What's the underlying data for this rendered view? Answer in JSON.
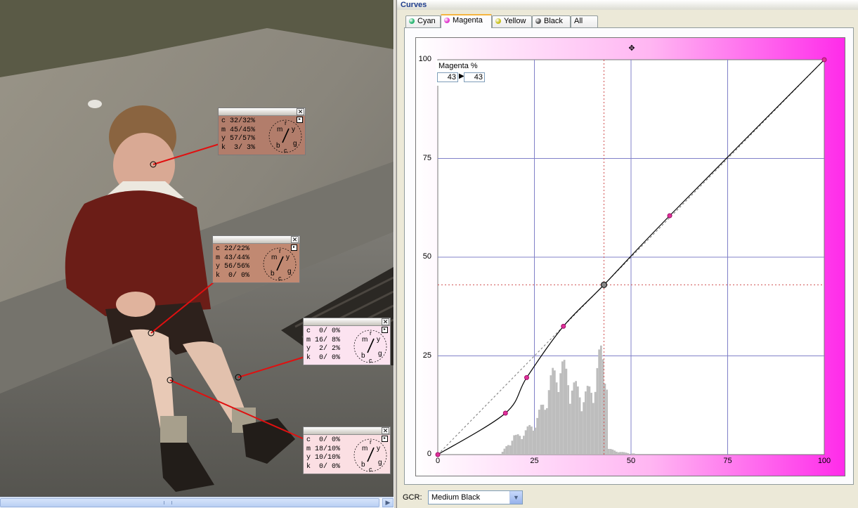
{
  "panel": {
    "title": "Curves"
  },
  "tabs": [
    {
      "label": "Cyan",
      "color": "#2bb673"
    },
    {
      "label": "Magenta",
      "color": "#e13dcf"
    },
    {
      "label": "Yellow",
      "color": "#c8c11e"
    },
    {
      "label": "Black",
      "color": "#555555"
    },
    {
      "label": "All",
      "color": ""
    }
  ],
  "curve": {
    "readout_label": "Magenta %",
    "input_value": "43",
    "output_value": "43",
    "y_ticks": [
      "100",
      "75",
      "50",
      "25",
      "0"
    ],
    "x_ticks": [
      "0",
      "25",
      "50",
      "75",
      "100"
    ],
    "control_points": [
      [
        0,
        0
      ],
      [
        17.5,
        10.5
      ],
      [
        23,
        19.5
      ],
      [
        32.5,
        32.5
      ],
      [
        43,
        43
      ],
      [
        60,
        60.5
      ],
      [
        100,
        100
      ]
    ],
    "selected_point": [
      43,
      43
    ]
  },
  "gcr": {
    "label": "GCR:",
    "value": "Medium Black"
  },
  "probes": [
    {
      "c": "32/32%",
      "m": "45/45%",
      "y": "57/57%",
      "k": " 3/ 3%",
      "bg": "#b27d6b"
    },
    {
      "c": "22/22%",
      "m": "43/44%",
      "y": "56/56%",
      "k": " 0/ 0%",
      "bg": "#c18972"
    },
    {
      "c": " 0/ 0%",
      "m": "16/ 8%",
      "y": " 2/ 2%",
      "k": " 0/ 0%",
      "bg": "#fce3f0"
    },
    {
      "c": " 0/ 0%",
      "m": "18/10%",
      "y": "10/10%",
      "k": " 0/ 0%",
      "bg": "#fbdfe3"
    }
  ],
  "colors": {
    "accent": "#ff00ee",
    "leader": "#e01010"
  }
}
